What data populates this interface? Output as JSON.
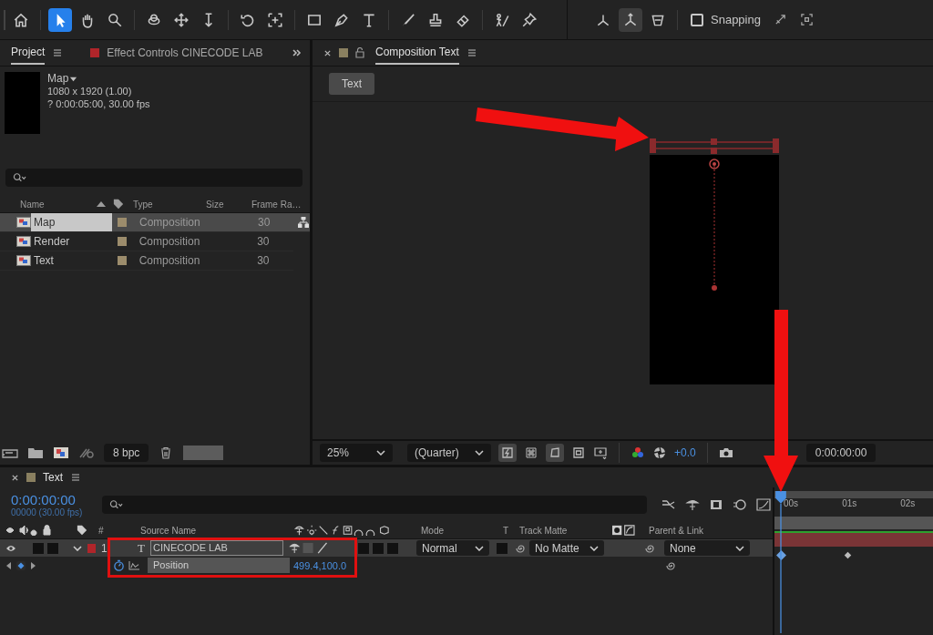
{
  "toolbar": {
    "tools": [
      {
        "kind": "home",
        "selected": false
      },
      {
        "kind": "selection",
        "selected": true
      },
      {
        "kind": "hand",
        "selected": false
      },
      {
        "kind": "zoom",
        "selected": false
      },
      {
        "kind": "orbit",
        "selected": false
      },
      {
        "kind": "pan",
        "selected": false
      },
      {
        "kind": "dolly",
        "selected": false
      },
      {
        "kind": "rotate",
        "selected": false
      },
      {
        "kind": "anchor",
        "selected": false
      },
      {
        "kind": "rectangle",
        "selected": false
      },
      {
        "kind": "pen",
        "selected": false
      },
      {
        "kind": "type",
        "selected": false
      },
      {
        "kind": "brush",
        "selected": false
      },
      {
        "kind": "stamp",
        "selected": false
      },
      {
        "kind": "eraser",
        "selected": false
      },
      {
        "kind": "roto",
        "selected": false
      },
      {
        "kind": "pin",
        "selected": false
      }
    ],
    "axes": [
      {
        "kind": "local-axis",
        "selected": false
      },
      {
        "kind": "world-axis",
        "selected": true
      },
      {
        "kind": "view-axis",
        "selected": false
      }
    ],
    "snapping": {
      "label": "Snapping",
      "checked": false
    }
  },
  "project_panel": {
    "tabs": [
      {
        "label": "Project",
        "selected": true
      },
      {
        "label": "Effect Controls CINECODE LAB",
        "selected": false
      }
    ],
    "preview": {
      "name": "Map",
      "size": "1080 x 1920 (1.00)",
      "duration": "? 0:00:05:00, 30.00 fps"
    },
    "columns": [
      "Name",
      "Type",
      "Size",
      "Frame Ra…"
    ],
    "rows": [
      {
        "name": "Map",
        "type": "Composition",
        "frame_rate": "30",
        "color": "#9c8c6c",
        "selected": true
      },
      {
        "name": "Render",
        "type": "Composition",
        "frame_rate": "30",
        "color": "#9c8c6c",
        "selected": false
      },
      {
        "name": "Text",
        "type": "Composition",
        "frame_rate": "30",
        "color": "#9c8c6c",
        "selected": false
      }
    ],
    "bit_depth": "8 bpc"
  },
  "composition_panel": {
    "tab": "Composition Text",
    "view_button": "Text",
    "zoom": "25%",
    "resolution": "(Quarter)",
    "exposure": "+0.0",
    "timecode": "0:00:00:00"
  },
  "timeline": {
    "tab": "Text",
    "timecode": "0:00:00:00",
    "frame_info": "00000 (30.00 fps)",
    "headers": {
      "number": "#",
      "source_name": "Source Name",
      "mode": "Mode",
      "t": "T",
      "track_matte": "Track Matte",
      "parent": "Parent & Link"
    },
    "layer": {
      "number": "1",
      "type": "T",
      "name": "CINECODE LAB",
      "color": "#b0252a",
      "mode": "Normal",
      "track_matte": "No Matte",
      "parent": "None",
      "expanded": true
    },
    "property": {
      "name": "Position",
      "value": "499.4,100.0"
    },
    "ruler": [
      "00s",
      "01s",
      "02s"
    ]
  }
}
